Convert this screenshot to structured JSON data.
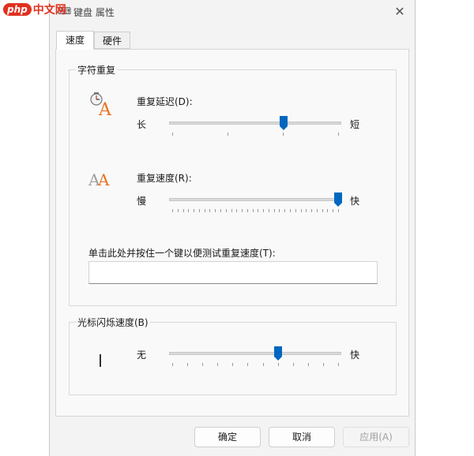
{
  "watermark": {
    "badge": "php",
    "text": "中文网"
  },
  "window": {
    "title": "键盘 属性",
    "close": "✕"
  },
  "tabs": [
    {
      "label": "速度"
    },
    {
      "label": "硬件"
    }
  ],
  "repeat_group": {
    "title": "字符重复",
    "delay": {
      "label": "重复延迟(D):",
      "left": "长",
      "right": "短",
      "value_fraction": 0.67,
      "tick_count": 4
    },
    "rate": {
      "label": "重复速度(R):",
      "left": "慢",
      "right": "快",
      "value_fraction": 1.0,
      "tick_count": 32
    },
    "test": {
      "label": "单击此处并按住一个键以便测试重复速度(T):",
      "value": ""
    }
  },
  "blink_group": {
    "title": "光标闪烁速度(B)",
    "left": "无",
    "right": "快",
    "value_fraction": 0.64,
    "tick_count": 12
  },
  "buttons": {
    "ok": "确定",
    "cancel": "取消",
    "apply": "应用(A)"
  },
  "colors": {
    "accent": "#0067c0",
    "icon_orange": "#e8741e",
    "icon_gray": "#9a9a9a"
  }
}
